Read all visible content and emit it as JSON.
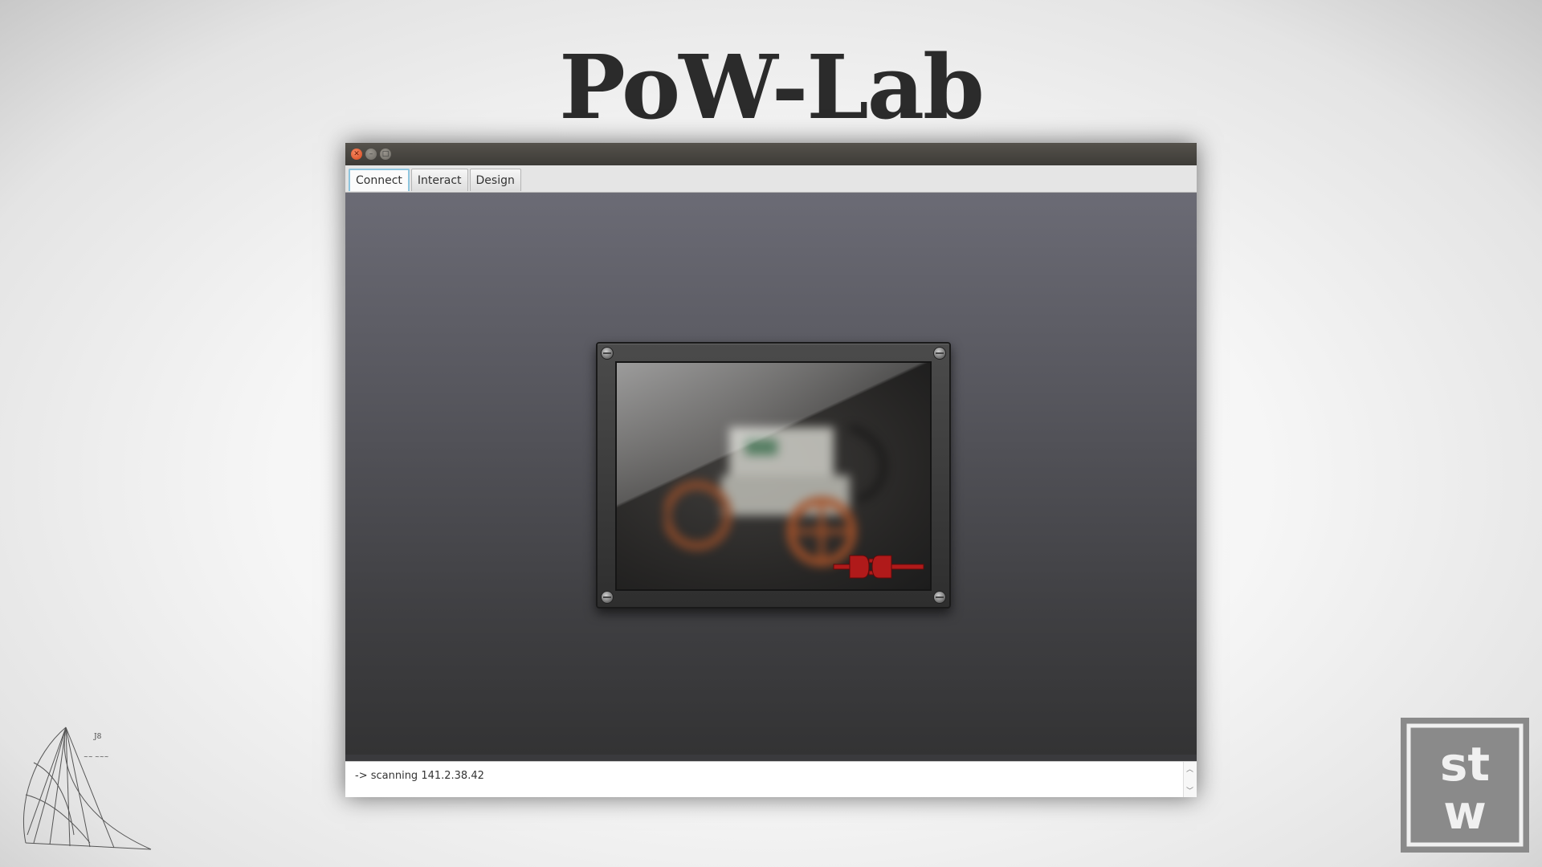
{
  "slide": {
    "title": "PoW-Lab"
  },
  "window": {
    "controls": {
      "close_icon": "close-icon",
      "minimize_icon": "minimize-icon",
      "maximize_icon": "maximize-icon"
    },
    "tabs": [
      {
        "label": "Connect",
        "active": true
      },
      {
        "label": "Interact",
        "active": false
      },
      {
        "label": "Design",
        "active": false
      }
    ],
    "device_panel": {
      "status_icon": "disconnected-plug-icon",
      "status_color": "#b01a1a"
    },
    "console": {
      "line": "-> scanning 141.2.38.42"
    }
  },
  "logos": {
    "left": "spiral-sketch-logo",
    "right_logo_text": "st w"
  }
}
